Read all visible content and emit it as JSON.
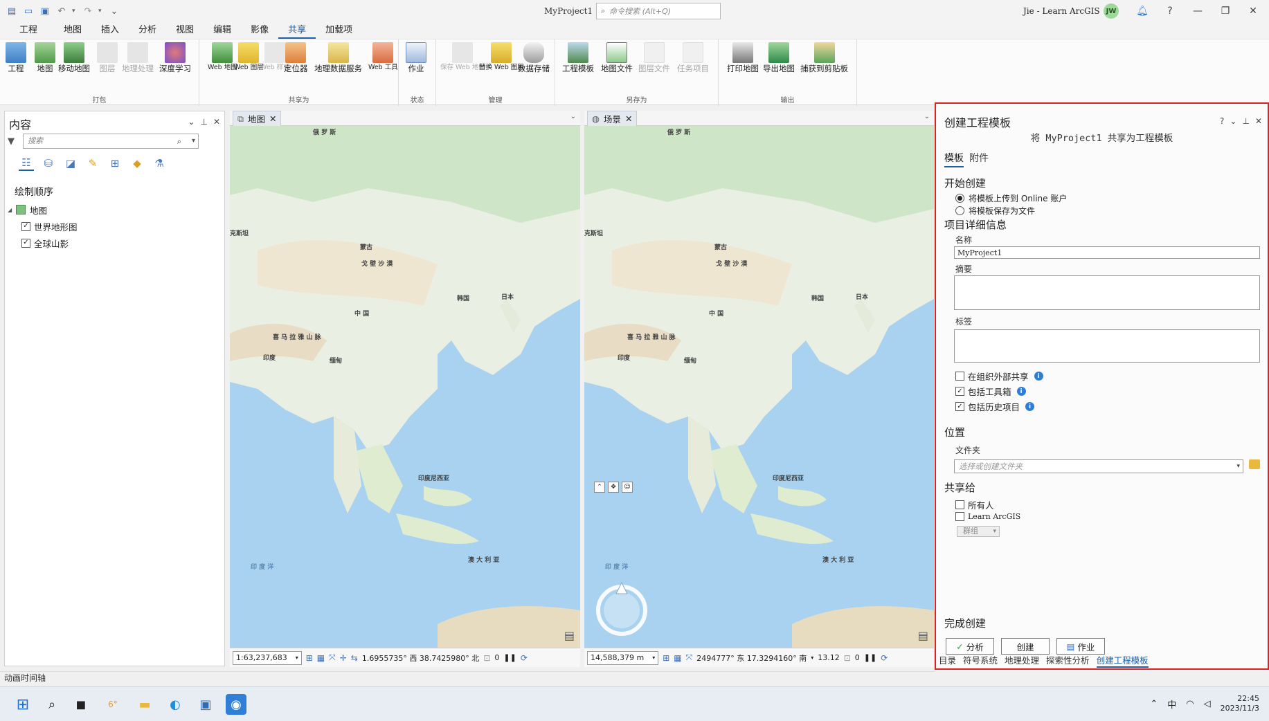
{
  "title_bar": {
    "project": "MyProject1",
    "command_search_placeholder": "命令搜索 (Alt+Q)",
    "user": "Jie - Learn ArcGIS",
    "avatar": "JW"
  },
  "menu_tabs": [
    "工程",
    "地图",
    "插入",
    "分析",
    "视图",
    "编辑",
    "影像",
    "共享",
    "加载项"
  ],
  "active_menu_tab": "共享",
  "ribbon": {
    "groups": [
      {
        "label": "打包",
        "buttons": [
          "工程",
          "地图",
          "移动地图",
          "图层",
          "地理处理",
          "深度学习"
        ]
      },
      {
        "label": "共享为",
        "buttons": [
          "Web 地图",
          "Web 图层",
          "Web 样式",
          "定位器",
          "地理数据服务",
          "Web 工具"
        ]
      },
      {
        "label": "状态",
        "buttons": [
          "作业"
        ]
      },
      {
        "label": "管理",
        "buttons": [
          "保存 Web 地图",
          "替换 Web 图层",
          "数据存储"
        ]
      },
      {
        "label": "另存为",
        "buttons": [
          "工程模板",
          "地图文件",
          "图层文件",
          "任务项目"
        ]
      },
      {
        "label": "输出",
        "buttons": [
          "打印地图",
          "导出地图",
          "捕获到剪贴板"
        ]
      }
    ]
  },
  "contents": {
    "title": "内容",
    "search_placeholder": "搜索",
    "draw_order": "绘制顺序",
    "map_name": "地图",
    "layers": [
      {
        "name": "世界地形图",
        "checked": true
      },
      {
        "name": "全球山影",
        "checked": true
      }
    ]
  },
  "map_view": {
    "tab": "地图",
    "scale": "1:63,237,683",
    "coords": "1.6955735° 西  38.7425980° 北",
    "selected": "0"
  },
  "scene_view": {
    "tab": "场景",
    "scale": "14,588,379 m",
    "coords": "2494777° 东  17.3294160° 南",
    "extra": "13.12",
    "selected": "0"
  },
  "map_labels": {
    "russia": "俄 罗 斯",
    "mongolia": "蒙古",
    "gobi": "戈 壁 沙 漠",
    "kazakh": "克斯坦",
    "china": "中 国",
    "korea": "韩国",
    "japan": "日本",
    "himalaya": "喜 马 拉 雅 山 脉",
    "india": "印度",
    "myanmar": "缅甸",
    "indonesia": "印度尼西亚",
    "australia": "澳 大 利 亚",
    "indian_ocean": "印 度 洋"
  },
  "create_template_pane": {
    "title": "创建工程模板",
    "subtitle": "将 MyProject1 共享为工程模板",
    "tabs": [
      "模板",
      "附件"
    ],
    "start_section": "开始创建",
    "radio_upload": "将模板上传到 Online 账户",
    "radio_save": "将模板保存为文件",
    "details_section": "项目详细信息",
    "name_label": "名称",
    "name_value": "MyProject1",
    "summary_label": "摘要",
    "tags_label": "标签",
    "share_outside": "在组织外部共享",
    "include_toolbox": "包括工具箱",
    "include_history": "包括历史项目",
    "location_section": "位置",
    "folder_label": "文件夹",
    "folder_placeholder": "选择或创建文件夹",
    "share_section": "共享给",
    "share_everyone": "所有人",
    "share_org": "Learn ArcGIS",
    "groups_label": "群组",
    "finish_section": "完成创建",
    "analyze_button": "分析",
    "create_button": "创建",
    "jobs_button": "作业",
    "bottom_tabs": [
      "目录",
      "符号系统",
      "地理处理",
      "探索性分析",
      "创建工程模板"
    ],
    "active_bottom_tab": "创建工程模板"
  },
  "animation_label": "动画时间轴",
  "taskbar": {
    "weather": "6°",
    "ime": "中",
    "time": "22:45",
    "date": "2023/11/3"
  }
}
